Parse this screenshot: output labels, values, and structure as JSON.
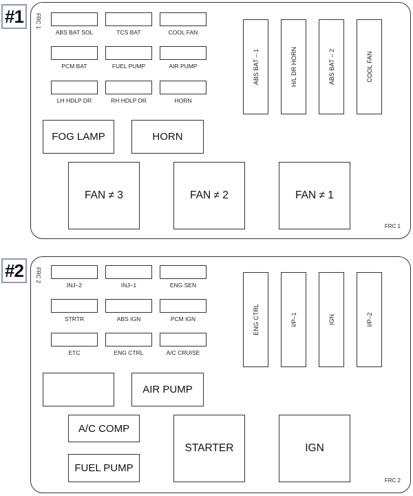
{
  "diagrams": [
    {
      "badge": "#1",
      "side_label": "FRC 1",
      "corner_label": "FRC 1",
      "mini_fuses": [
        [
          "ABS BAT SOL",
          "TCS BAT",
          "COOL FAN"
        ],
        [
          "PCM BAT",
          "FUEL PUMP",
          "AIR PUMP"
        ],
        [
          "LH HDLP DR",
          "RH HDLP DR",
          "HORN"
        ]
      ],
      "tall_fuses": [
        "ABS BAT – 1",
        "H/L DR HORN",
        "ABS BAT – 2",
        "COOL FAN"
      ],
      "medium_relays": [
        "FOG LAMP",
        "HORN"
      ],
      "large_relays": [
        "FAN ≠ 3",
        "FAN ≠ 2",
        "FAN ≠ 1"
      ]
    },
    {
      "badge": "#2",
      "side_label": "FRC 2",
      "corner_label": "FRC 2",
      "mini_fuses": [
        [
          "INJ–2",
          "INJ–1",
          "ENG SEN"
        ],
        [
          "STRTR",
          "ABS IGN",
          "PCM IGN"
        ],
        [
          "ETC",
          "ENG CTRL",
          "A/C CRUISE"
        ]
      ],
      "tall_fuses": [
        "ENG CTRL",
        "I/P–1",
        "IGN",
        "I/P–2"
      ],
      "medium_relays": [
        "",
        "AIR PUMP",
        "A/C COMP",
        "FUEL PUMP"
      ],
      "large_relays": [
        "STARTER",
        "IGN"
      ]
    }
  ]
}
